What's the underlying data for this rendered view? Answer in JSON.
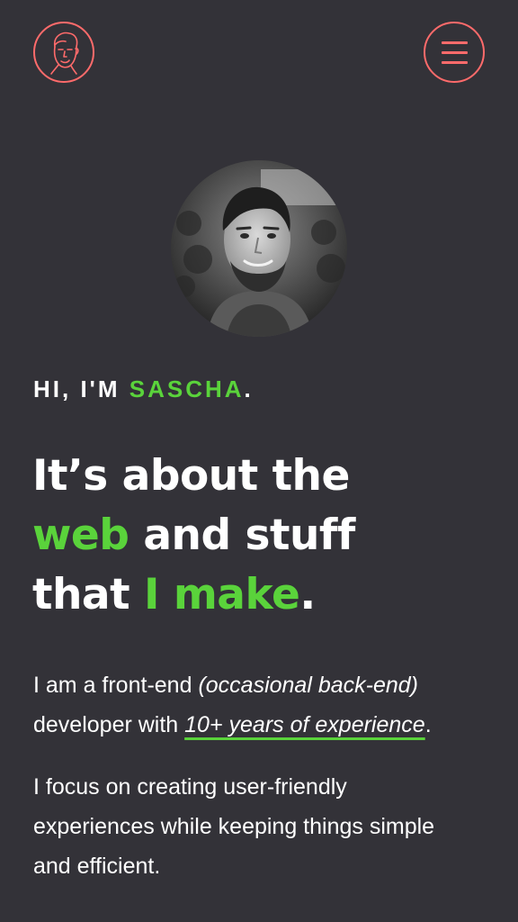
{
  "header": {
    "logo_icon": "face-doodle-icon",
    "menu_icon": "hamburger-menu-icon",
    "accent_color": "#ff6b6b"
  },
  "hero": {
    "avatar_icon": "profile-photo",
    "greeting": {
      "prefix": "HI, I'M ",
      "name": "SASCHA",
      "suffix": "."
    },
    "headline": {
      "line1": "It’s about the",
      "line2_highlight": "web",
      "line2_rest": " and stuff",
      "line3_plain": "that ",
      "line3_highlight": "I make",
      "line3_end": "."
    },
    "intro": {
      "line1_plain": "I am a front-end ",
      "line1_italic": "(occasional back-end)",
      "line2_plain": "developer with ",
      "line2_link": "10+ years of experience",
      "line2_end": "."
    },
    "focus": {
      "line1": "I focus on creating user-friendly",
      "line2": "experiences while keeping things simple",
      "line3": "and efficient."
    }
  },
  "colors": {
    "background": "#333238",
    "highlight": "#5ad33b",
    "text": "#ffffff"
  }
}
